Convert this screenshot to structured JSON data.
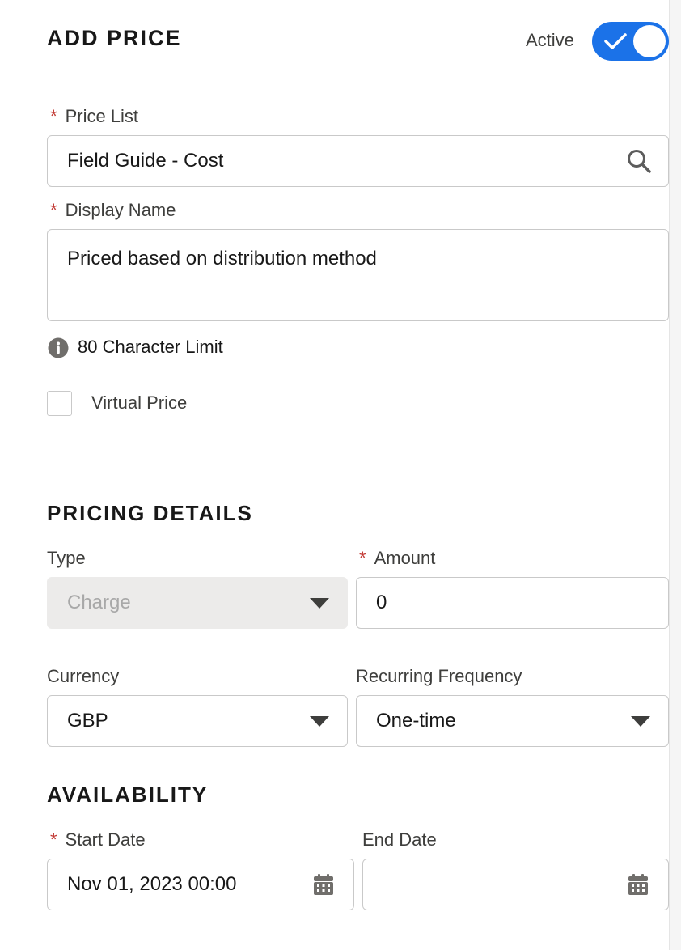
{
  "add_price": {
    "title": "ADD PRICE",
    "active_label": "Active",
    "active": true
  },
  "price_list": {
    "label": "Price List",
    "required_mark": "*",
    "value": "Field Guide - Cost",
    "icon": "search-icon"
  },
  "display_name": {
    "label": "Display Name",
    "required_mark": "*",
    "value": "Priced based on distribution method"
  },
  "char_limit": {
    "icon": "info-icon",
    "text": "80 Character Limit"
  },
  "virtual_price": {
    "label": "Virtual Price",
    "checked": false
  },
  "pricing_details": {
    "title": "PRICING DETAILS",
    "type": {
      "label": "Type",
      "value": "Charge"
    },
    "amount": {
      "label": "Amount",
      "required_mark": "*",
      "value": "0"
    },
    "currency": {
      "label": "Currency",
      "value": "GBP"
    },
    "recurring_frequency": {
      "label": "Recurring Frequency",
      "value": "One-time"
    }
  },
  "availability": {
    "title": "AVAILABILITY",
    "start_date": {
      "label": "Start Date",
      "required_mark": "*",
      "value": "Nov 01, 2023 00:00",
      "icon": "calendar-icon"
    },
    "end_date": {
      "label": "End Date",
      "value": "",
      "icon": "calendar-icon"
    }
  },
  "colors": {
    "toggle_active": "#1b72e8",
    "required": "#c23934",
    "disabled_field": "#ecebea"
  }
}
